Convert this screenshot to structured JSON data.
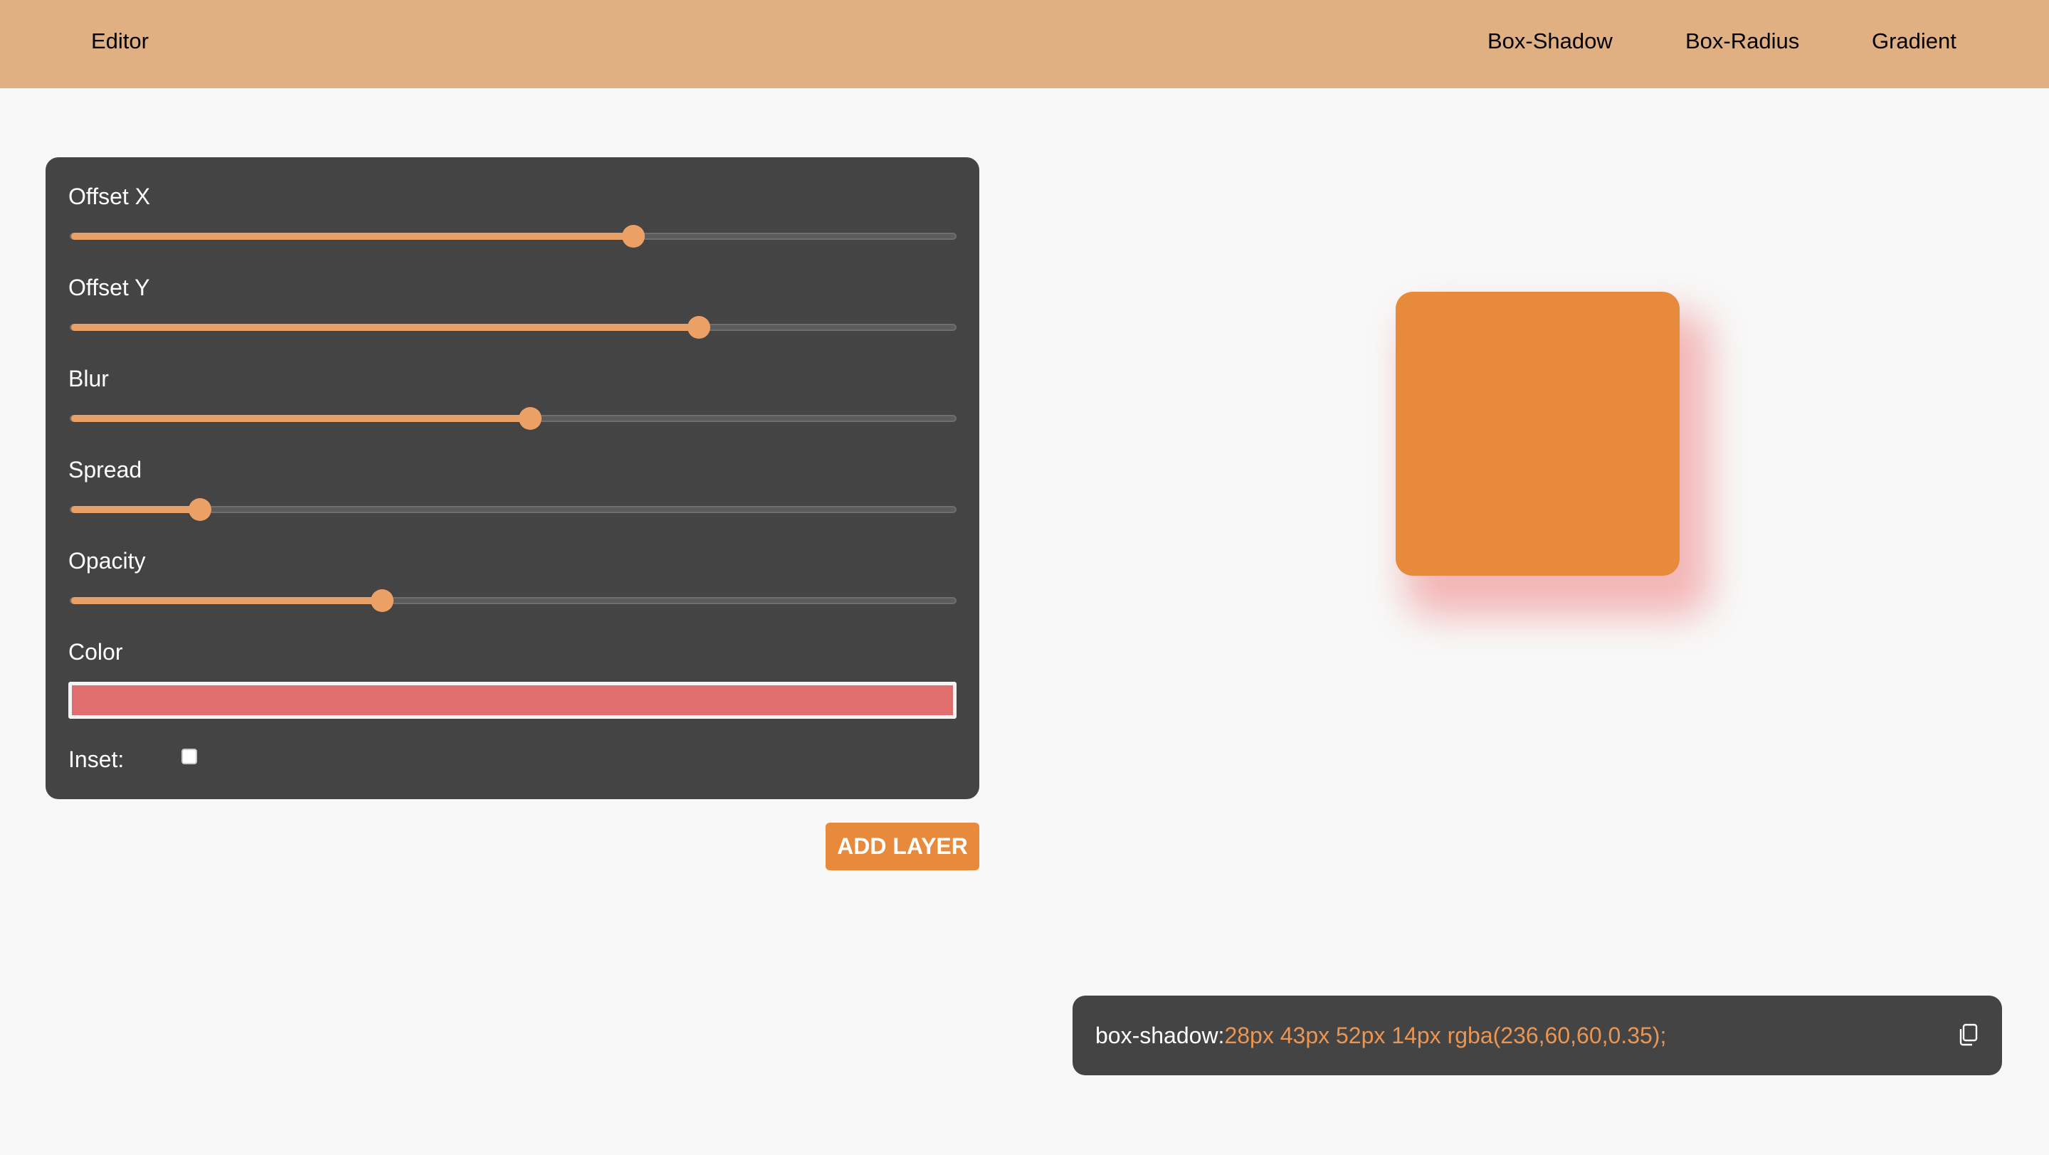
{
  "header": {
    "brand": "Editor",
    "nav": [
      "Box-Shadow",
      "Box-Radius",
      "Gradient"
    ]
  },
  "controls": [
    {
      "label": "Offset X",
      "fraction": 0.636
    },
    {
      "label": "Offset Y",
      "fraction": 0.71
    },
    {
      "label": "Blur",
      "fraction": 0.519
    },
    {
      "label": "Spread",
      "fraction": 0.146
    },
    {
      "label": "Opacity",
      "fraction": 0.352
    }
  ],
  "color": {
    "label": "Color",
    "value": "#e06e6e"
  },
  "inset": {
    "label": "Inset:",
    "checked": false
  },
  "add_layer_label": "ADD LAYER",
  "output": {
    "property": "box-shadow:",
    "value": "28px 43px 52px 14px rgba(236,60,60,0.35);"
  },
  "colors": {
    "accent": "#e88a3c",
    "header_bg": "#e0b083",
    "panel_bg": "#444444",
    "page_bg": "#f8f8f8",
    "shadow": "rgba(236,60,60,0.35)"
  },
  "icons": {
    "copy": "copy-icon"
  }
}
